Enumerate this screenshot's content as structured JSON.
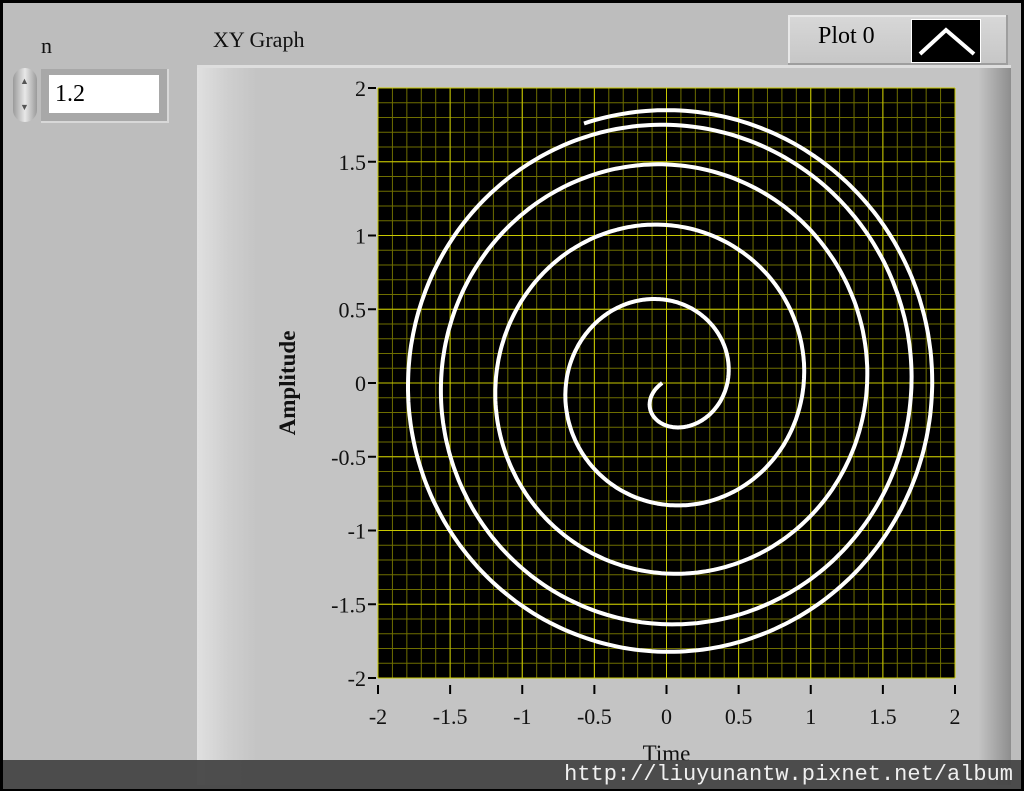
{
  "controls": {
    "n_label": "n",
    "n_value": "1.2"
  },
  "graph": {
    "label": "XY Graph",
    "legend": {
      "plot_name": "Plot 0"
    }
  },
  "watermark": "http://liuyunantw.pixnet.net/album",
  "colors": {
    "plot_bg": "#000000",
    "grid_major": "#c8c800",
    "grid_minor": "#6e6e00",
    "trace": "#ffffff"
  },
  "chart_data": {
    "type": "line",
    "title": "XY Graph",
    "xlabel": "Time",
    "ylabel": "Amplitude",
    "xlim": [
      -2,
      2
    ],
    "ylim": [
      -2,
      2
    ],
    "xticks": [
      "-2",
      "-1.5",
      "-1",
      "-0.5",
      "0",
      "0.5",
      "1",
      "1.5",
      "2"
    ],
    "yticks": [
      "2",
      "1.5",
      "1",
      "0.5",
      "0",
      "-0.5",
      "-1",
      "-1.5",
      "-2"
    ],
    "grid": true,
    "legend": "top-right",
    "series": [
      {
        "name": "Plot 0",
        "parametric": {
          "theta_start": 0,
          "theta_end_pi": 9.6,
          "r0": 0.15,
          "r_amp": 1.7,
          "center": [
            0,
            0
          ]
        },
        "loop_extents_y": [
          0.52,
          1.0,
          1.4,
          1.68,
          1.82
        ]
      }
    ]
  }
}
